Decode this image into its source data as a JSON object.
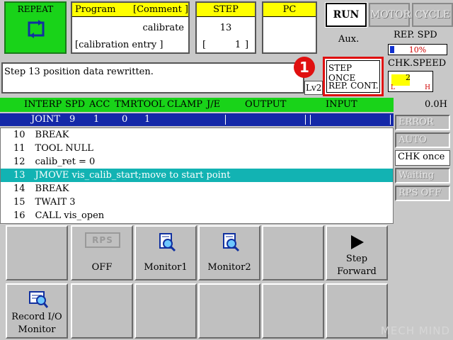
{
  "top": {
    "repeat_label": "REPEAT",
    "program_header": "Program",
    "comment_header": "[Comment ]",
    "program_name": "calibrate",
    "comment_value": "[calibration entry ]",
    "step_header": "STEP",
    "step_value": "13",
    "step_sub_left": "[",
    "step_sub_value": "1",
    "step_sub_right": "]",
    "pc_header": "PC",
    "run_label": "RUN",
    "motor_label": "MOTOR",
    "cycle_label": "CYCLE",
    "aux_label": "Aux.",
    "rep_spd_label": "REP. SPD",
    "rep_spd_value": "10%",
    "chk_speed_label": "CHK.SPEED",
    "chk_speed_value": "2",
    "chk_speed_low": "L",
    "chk_speed_high": "H"
  },
  "message": {
    "text": "Step 13 position data rewritten.",
    "level": "Lv2"
  },
  "step_mode": {
    "line1": "STEP ONCE",
    "line2": "REP. CONT.",
    "badge": "1"
  },
  "table": {
    "headers": [
      "INTERP",
      "SPD",
      "ACC",
      "TMR",
      "TOOL",
      "CLAMP",
      "J/E",
      "OUTPUT",
      "INPUT"
    ],
    "time": "0.0H",
    "joint_row": [
      "JOINT",
      "9",
      "1",
      "0",
      "1"
    ],
    "lines": [
      {
        "num": "10",
        "code": "BREAK"
      },
      {
        "num": "11",
        "code": "TOOL NULL"
      },
      {
        "num": "12",
        "code": "calib_ret = 0"
      },
      {
        "num": "13",
        "code": "JMOVE vis_calib_start;move to start point"
      },
      {
        "num": "14",
        "code": "BREAK"
      },
      {
        "num": "15",
        "code": "TWAIT 3"
      },
      {
        "num": "16",
        "code": "CALL vis_open"
      }
    ],
    "selected_index": 3
  },
  "status": [
    "ERROR",
    "AUTO",
    "CHK once",
    "Waiting",
    "RPS OFF"
  ],
  "status_active_index": 2,
  "fkeys": {
    "rps_icon": "RPS",
    "rps_label": "OFF",
    "monitor1": "Monitor1",
    "monitor2": "Monitor2",
    "step_forward_line1": "Step",
    "step_forward_line2": "Forward",
    "record_io_line1": "Record I/O",
    "record_io_line2": "Monitor"
  },
  "watermark": "MECH MIND",
  "colors": {
    "green": "#19d319",
    "yellow": "#ffff00",
    "blue": "#1428a8",
    "teal": "#12b3b3",
    "red": "#e01010"
  }
}
